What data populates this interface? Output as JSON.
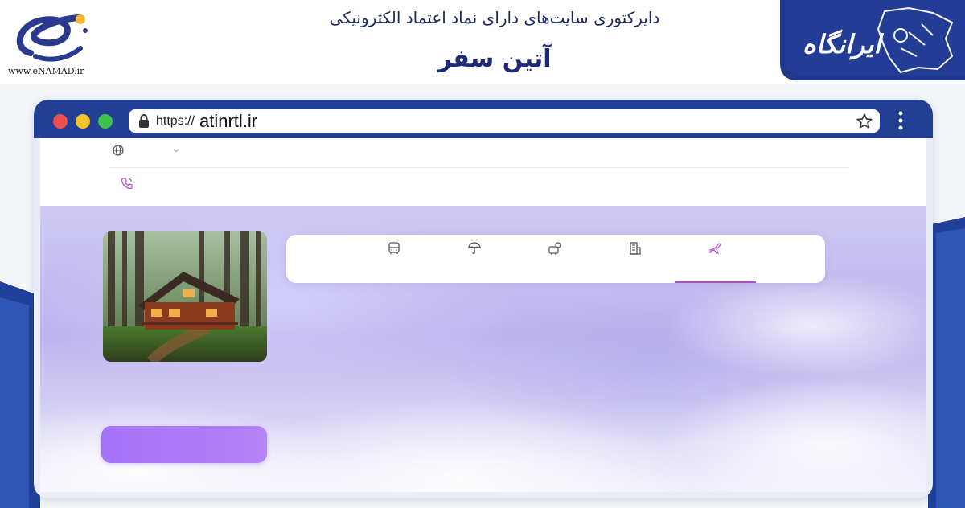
{
  "header": {
    "enamad_url": "www.eNAMAD.ir",
    "subtitle": "دایرکتوری سایت‌های دارای نماد اعتماد الکترونیکی",
    "title": "آتین سفر",
    "badge_text": "ایرانگاه"
  },
  "browser": {
    "url_prefix": "https://",
    "url_host": "atinrtl.ir"
  },
  "site": {
    "tabs": [
      {
        "icon": "bus-icon",
        "active": false
      },
      {
        "icon": "beach-umbrella-icon",
        "active": false
      },
      {
        "icon": "tour-icon",
        "active": false
      },
      {
        "icon": "hotel-icon",
        "active": false
      },
      {
        "icon": "flight-icon",
        "active": true
      }
    ]
  },
  "colors": {
    "browser_bar": "#223f94",
    "accent_purple": "#a471f7",
    "title_blue": "#1e2a78"
  }
}
